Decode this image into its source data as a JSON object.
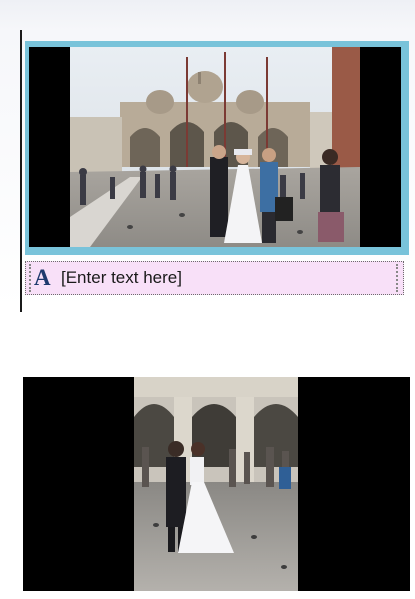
{
  "caption": {
    "icon": "A",
    "placeholder_text": "[Enter text here]"
  },
  "slides": [
    {
      "name": "St Mark's Square wedding couple",
      "selected": true
    },
    {
      "name": "Wedding couple dancing under arcade",
      "selected": false
    }
  ],
  "colors": {
    "selection_border": "#79c3da",
    "caption_background": "#f8e0f8",
    "caption_icon": "#1f3a6e"
  }
}
